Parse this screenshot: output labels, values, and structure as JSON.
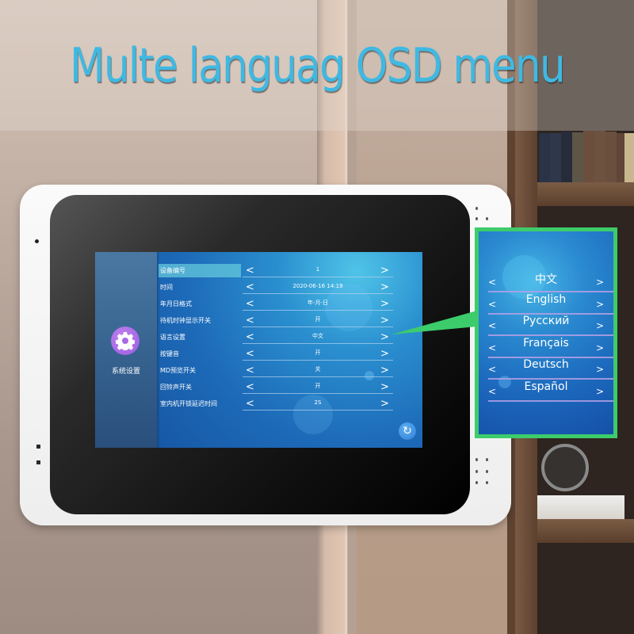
{
  "headline": "Multe languag OSD menu",
  "device_screen": {
    "sidebar": {
      "icon": "gear-icon",
      "label": "系统设置",
      "accent_color": "#a86ae6"
    },
    "settings": [
      {
        "label": "设备编号",
        "value": "1",
        "active": true
      },
      {
        "label": "时间",
        "value": "2020-06-16   14:19",
        "active": false
      },
      {
        "label": "年月日格式",
        "value": "年-月-日",
        "active": false
      },
      {
        "label": "待机时钟显示开关",
        "value": "开",
        "active": false
      },
      {
        "label": "语言设置",
        "value": "中文",
        "active": false
      },
      {
        "label": "按键音",
        "value": "开",
        "active": false
      },
      {
        "label": "MD预览开关",
        "value": "关",
        "active": false
      },
      {
        "label": "回铃声开关",
        "value": "开",
        "active": false
      },
      {
        "label": "室内机开锁延迟时间",
        "value": "2S",
        "active": false
      }
    ],
    "left_arrow": "<",
    "right_arrow": ">",
    "refresh_icon": "refresh-icon",
    "refresh_glyph": "↻"
  },
  "language_callout": {
    "border_color": "#3dcc6b",
    "languages": [
      "中文",
      "English",
      "Русский",
      "Français",
      "Deutsch",
      "Español"
    ],
    "left_arrow": "<",
    "right_arrow": ">"
  }
}
